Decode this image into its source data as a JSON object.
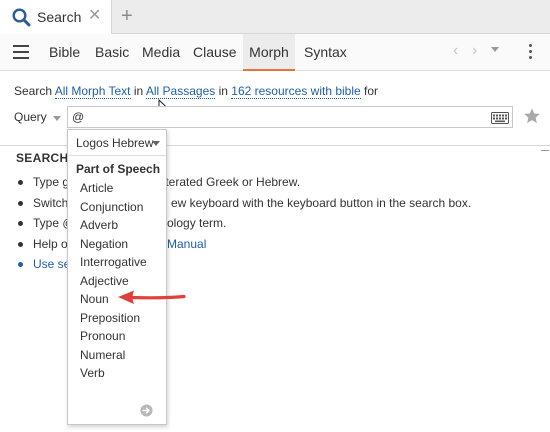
{
  "tab": {
    "label": "Search",
    "close": "✕",
    "new": "+"
  },
  "toolbar": {
    "tabs": [
      "Bible",
      "Basic",
      "Media",
      "Clause",
      "Morph",
      "Syntax"
    ],
    "active": "Morph",
    "back": "‹",
    "forward": "›"
  },
  "search_line": {
    "prefix": "Search",
    "text_type": "All Morph Text",
    "in1": "in",
    "passages": "All Passages",
    "in2": "in",
    "resources": "162 resources with bible",
    "suffix": "for"
  },
  "query": {
    "label": "Query",
    "value": "@"
  },
  "help": {
    "heading": "SEARCH",
    "items": [
      {
        "pre": "Type g",
        "post": "literated Greek or Hebrew.",
        "link": false
      },
      {
        "pre": "Switch",
        "post": "ew keyboard with the keyboard button in the search box.",
        "link": false
      },
      {
        "pre": "Type @",
        "post": "ology term.",
        "link": false
      },
      {
        "pre": "Help o",
        "post": "Manual",
        "link": false,
        "post_link": true
      },
      {
        "pre": "Use se",
        "post": "",
        "link": true
      }
    ]
  },
  "dropdown": {
    "language": "Logos Hebrew",
    "heading": "Part of Speech",
    "items": [
      "Article",
      "Conjunction",
      "Adverb",
      "Negation",
      "Interrogative",
      "Adjective",
      "Noun",
      "Preposition",
      "Pronoun",
      "Numeral",
      "Verb"
    ],
    "highlighted": "Noun"
  },
  "colors": {
    "link": "#1f5fa8",
    "active_tab_underline": "#e8743b",
    "annotation_arrow": "#e0403a"
  },
  "icons": [
    "search-icon",
    "close-icon",
    "plus-icon",
    "menu-icon",
    "chevron-left-icon",
    "chevron-right-icon",
    "chevron-down-icon",
    "kebab-icon",
    "keyboard-icon",
    "star-icon",
    "mouse-cursor-icon",
    "next-arrow-icon",
    "annotation-arrow-icon"
  ]
}
